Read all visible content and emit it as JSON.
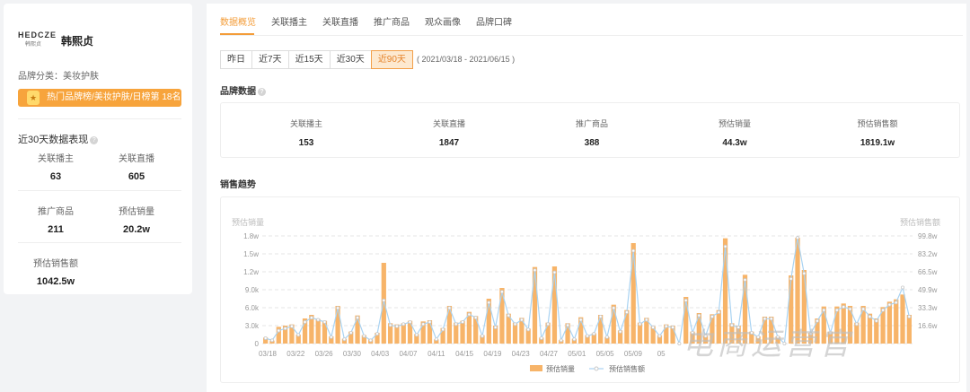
{
  "brand": {
    "logo_text": "HEDCZE",
    "logo_sub": "韩熙贞",
    "name": "韩熙贞",
    "category": "品牌分类：美妆护肤",
    "rank_banner": "热门品牌榜/美妆护肤/日榜第 18名"
  },
  "recent": {
    "title": "近30天数据表现",
    "stats": [
      {
        "label": "关联播主",
        "value": "63"
      },
      {
        "label": "关联直播",
        "value": "605"
      },
      {
        "label": "推广商品",
        "value": "211"
      },
      {
        "label": "预估销量",
        "value": "20.2w"
      },
      {
        "label": "预估销售额",
        "value": "1042.5w"
      }
    ]
  },
  "tabs": [
    "数据概览",
    "关联播主",
    "关联直播",
    "推广商品",
    "观众画像",
    "品牌口碑"
  ],
  "active_tab": 0,
  "ranges": [
    "昨日",
    "近7天",
    "近15天",
    "近30天",
    "近90天"
  ],
  "active_range": 4,
  "date_range": "( 2021/03/18 - 2021/06/15 )",
  "brand_data": {
    "title": "品牌数据",
    "stats": [
      {
        "label": "关联播主",
        "value": "153"
      },
      {
        "label": "关联直播",
        "value": "1847"
      },
      {
        "label": "推广商品",
        "value": "388"
      },
      {
        "label": "预估销量",
        "value": "44.3w"
      },
      {
        "label": "预估销售额",
        "value": "1819.1w"
      }
    ]
  },
  "trend_title": "销售趋势",
  "watermark": "电商运营官",
  "colors": {
    "accent": "#f39c38",
    "bar": "#f7b469",
    "line": "#a9d3f2"
  },
  "chart_data": {
    "type": "bar",
    "ylabel": "预估销量",
    "y2label": "预估销售额",
    "yticks": [
      "0",
      "3.0k",
      "6.0k",
      "9.0k",
      "1.2w",
      "1.5w",
      "1.8w"
    ],
    "ylim": [
      0,
      18000
    ],
    "y2ticks": [
      "16.6w",
      "33.3w",
      "49.9w",
      "66.5w",
      "83.2w",
      "99.8w"
    ],
    "y2lim": [
      0,
      99.8
    ],
    "xticks": [
      "03/18",
      "03/22",
      "03/26",
      "03/30",
      "04/03",
      "04/07",
      "04/11",
      "04/15",
      "04/19",
      "04/23",
      "04/27",
      "05/01",
      "05/05",
      "05/09",
      "05"
    ],
    "grid": true,
    "legend_position": "bottom-center",
    "series": [
      {
        "name": "预估销量",
        "kind": "bar",
        "values": [
          1000,
          500,
          2800,
          3000,
          3200,
          1500,
          4200,
          4800,
          4100,
          3800,
          1200,
          6300,
          800,
          2000,
          4700,
          1400,
          700,
          1800,
          13500,
          3400,
          3200,
          3400,
          3800,
          1600,
          3700,
          3900,
          700,
          2600,
          6300,
          3500,
          3800,
          5300,
          4600,
          1400,
          7500,
          3000,
          9300,
          5000,
          3500,
          4300,
          2500,
          12800,
          1000,
          3500,
          12900,
          600,
          3400,
          800,
          4400,
          1400,
          1700,
          4800,
          1100,
          6500,
          2200,
          5600,
          16800,
          3500,
          4300,
          2900,
          1400,
          3200,
          3000,
          0,
          7800,
          2000,
          5100,
          1300,
          4900,
          5600,
          17600,
          3400,
          3000,
          11500,
          2000,
          1200,
          4500,
          4500,
          1200,
          0,
          11400,
          17700,
          12300,
          1800,
          4200,
          6200,
          2000,
          6200,
          6700,
          6300,
          3500,
          6300,
          5000,
          4200,
          6100,
          7000,
          7400,
          8200,
          4800
        ]
      },
      {
        "name": "预估销售额",
        "kind": "line",
        "values": [
          5,
          3,
          12,
          14,
          16,
          8,
          20,
          24,
          22,
          20,
          6,
          33,
          4,
          10,
          24,
          7,
          3,
          9,
          40,
          17,
          16,
          18,
          20,
          8,
          18,
          20,
          4,
          13,
          33,
          18,
          20,
          27,
          24,
          7,
          38,
          15,
          48,
          26,
          18,
          22,
          13,
          68,
          5,
          18,
          66,
          3,
          17,
          4,
          22,
          7,
          9,
          25,
          6,
          33,
          11,
          29,
          86,
          18,
          22,
          15,
          7,
          16,
          15,
          0,
          40,
          10,
          26,
          7,
          25,
          29,
          90,
          17,
          15,
          59,
          10,
          6,
          23,
          23,
          6,
          0,
          60,
          98,
          65,
          9,
          21,
          31,
          10,
          31,
          34,
          32,
          18,
          32,
          25,
          21,
          31,
          36,
          38,
          52,
          25
        ]
      }
    ]
  }
}
